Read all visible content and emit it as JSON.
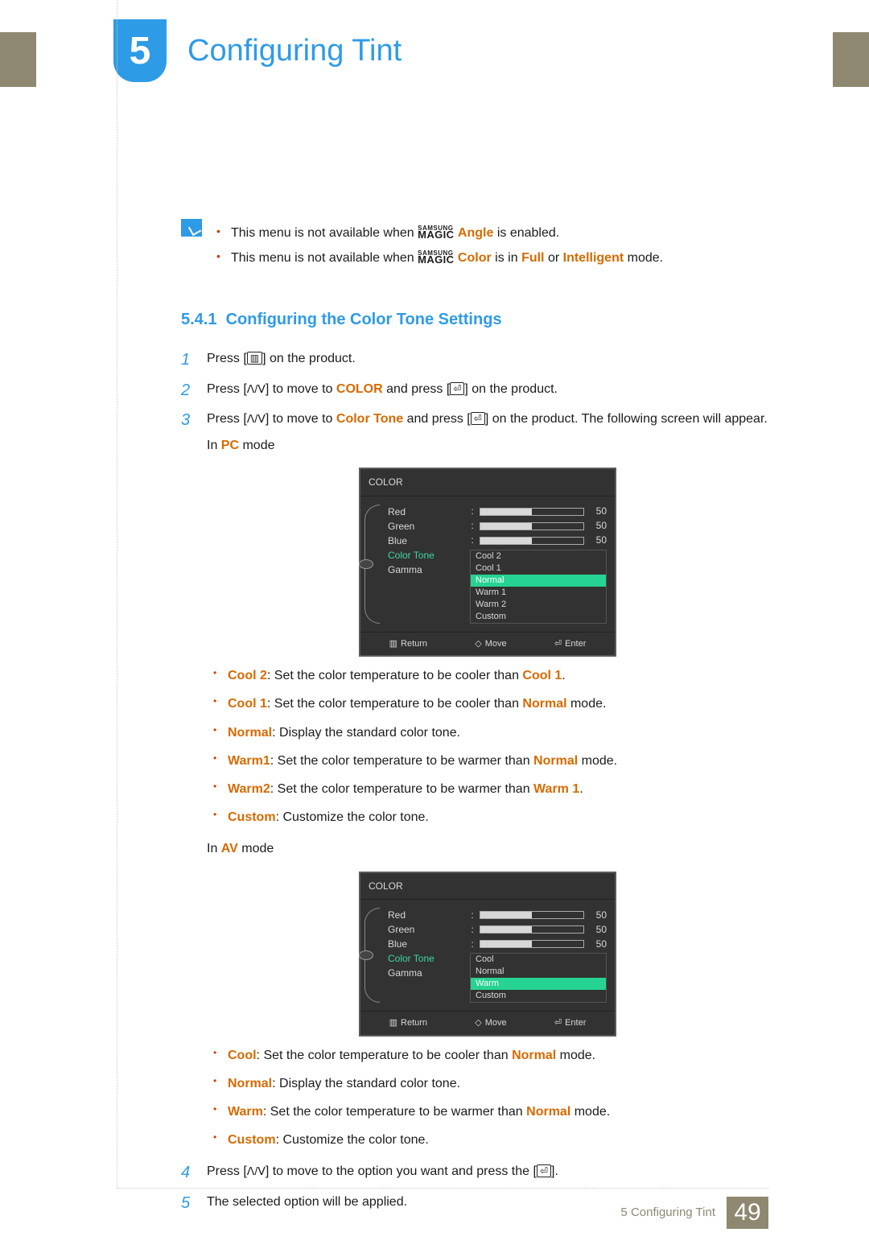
{
  "chapter_number": "5",
  "title": "Configuring Tint",
  "magic_brand_small": "SAMSUNG",
  "magic_brand_big": "MAGIC",
  "notes": [
    {
      "pre": "This menu is not available when ",
      "term": "Angle",
      "post": " is enabled."
    },
    {
      "pre": "This menu is not available when ",
      "term": "Color",
      "post": " is in ",
      "term2": "Full",
      "mid": " or ",
      "term3": "Intelligent",
      "tail": " mode."
    }
  ],
  "section": {
    "number": "5.4.1",
    "title": "Configuring the Color Tone Settings"
  },
  "steps": {
    "s1": {
      "pre": "Press [",
      "icon": "menu",
      "post": "] on the product."
    },
    "s2": {
      "pre": "Press [",
      "icon1": "updown",
      "mid1": "] to move to ",
      "term": "COLOR",
      "mid2": " and press [",
      "icon2": "enter",
      "post": "] on the product."
    },
    "s3": {
      "pre": "Press [",
      "icon1": "updown",
      "mid1": "] to move to ",
      "term": "Color Tone",
      "mid2": " and press [",
      "icon2": "enter",
      "post": "] on the product. The following screen will appear."
    },
    "s3_in_pc_pre": "In ",
    "s3_in_pc_term": "PC",
    "s3_in_pc_post": " mode",
    "s3_in_av_pre": "In ",
    "s3_in_av_term": "AV",
    "s3_in_av_post": " mode",
    "s4": {
      "pre": "Press [",
      "icon1": "updown",
      "mid": "] to move to the option you want and press the [",
      "icon2": "enter",
      "post": "]."
    },
    "s5": "The selected option will be applied."
  },
  "osd_pc": {
    "title": "COLOR",
    "rows": [
      "Red",
      "Green",
      "Blue"
    ],
    "values": [
      "50",
      "50",
      "50"
    ],
    "color_tone_label": "Color Tone",
    "gamma_label": "Gamma",
    "options": [
      "Cool 2",
      "Cool 1",
      "Normal",
      "Warm 1",
      "Warm 2",
      "Custom"
    ],
    "selected": "Normal",
    "footer": {
      "return": "Return",
      "move": "Move",
      "enter": "Enter"
    }
  },
  "osd_av": {
    "title": "COLOR",
    "rows": [
      "Red",
      "Green",
      "Blue"
    ],
    "values": [
      "50",
      "50",
      "50"
    ],
    "color_tone_label": "Color Tone",
    "gamma_label": "Gamma",
    "options": [
      "Cool",
      "Normal",
      "Warm",
      "Custom"
    ],
    "selected": "Warm",
    "footer": {
      "return": "Return",
      "move": "Move",
      "enter": "Enter"
    }
  },
  "bullets_pc": [
    {
      "term": "Cool 2",
      "mid": ": Set the color temperature to be cooler than ",
      "ref": "Cool 1",
      "tail": "."
    },
    {
      "term": "Cool 1",
      "mid": ": Set the color temperature to be cooler than ",
      "ref": "Normal",
      "tail": " mode."
    },
    {
      "term": "Normal",
      "mid": ": Display the standard color tone.",
      "ref": "",
      "tail": ""
    },
    {
      "term": "Warm1",
      "mid": ": Set the color temperature to be warmer than ",
      "ref": "Normal",
      "tail": " mode."
    },
    {
      "term": "Warm2",
      "mid": ": Set the color temperature to be warmer than ",
      "ref": "Warm 1",
      "tail": "."
    },
    {
      "term": "Custom",
      "mid": ": Customize the color tone.",
      "ref": "",
      "tail": ""
    }
  ],
  "bullets_av": [
    {
      "term": "Cool",
      "mid": ": Set the color temperature to be cooler than ",
      "ref": "Normal",
      "tail": " mode."
    },
    {
      "term": "Normal",
      "mid": ": Display the standard color tone.",
      "ref": "",
      "tail": ""
    },
    {
      "term": "Warm",
      "mid": ": Set the color temperature to be warmer than ",
      "ref": "Normal",
      "tail": " mode."
    },
    {
      "term": "Custom",
      "mid": ": Customize the color tone.",
      "ref": "",
      "tail": ""
    }
  ],
  "footer": {
    "label_prefix": "5 ",
    "label": "Configuring Tint",
    "page": "49"
  },
  "glyphs": {
    "menu": "▥",
    "updown": "ᐱ/ᐯ",
    "enter": "⏎",
    "move": "◇"
  }
}
